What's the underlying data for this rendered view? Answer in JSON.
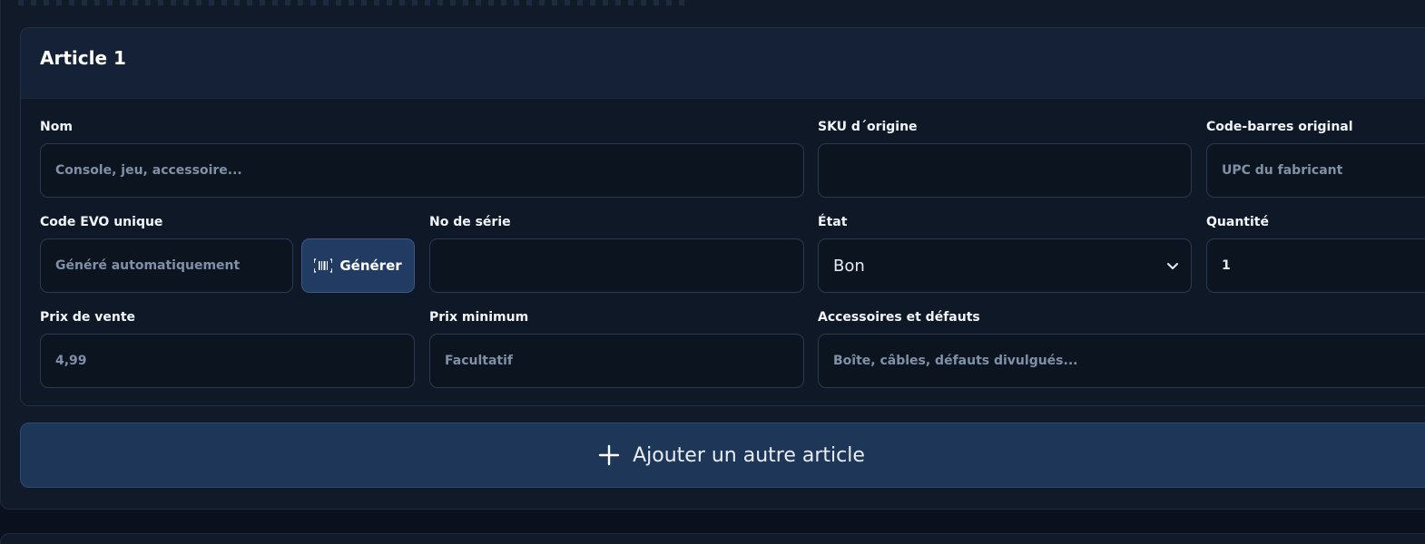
{
  "article": {
    "title": "Article 1",
    "fields": {
      "nom": {
        "label": "Nom",
        "placeholder": "Console, jeu, accessoire...",
        "value": ""
      },
      "sku": {
        "label": "SKU d´origine",
        "placeholder": "",
        "value": ""
      },
      "barcode": {
        "label": "Code-barres original",
        "placeholder": "UPC du fabricant",
        "value": ""
      },
      "evo": {
        "label": "Code EVO unique",
        "placeholder": "Généré automatiquement",
        "value": ""
      },
      "generate_label": "Générer",
      "serial": {
        "label": "No de série",
        "placeholder": "",
        "value": ""
      },
      "etat": {
        "label": "État",
        "value": "Bon"
      },
      "quantite": {
        "label": "Quantité",
        "value": "1"
      },
      "prix_vente": {
        "label": "Prix de vente",
        "placeholder": "4,99",
        "value": ""
      },
      "prix_min": {
        "label": "Prix minimum",
        "placeholder": "Facultatif",
        "value": ""
      },
      "accessoires": {
        "label": "Accessoires et défauts",
        "placeholder": "Boîte, câbles, défauts divulgués...",
        "value": ""
      }
    }
  },
  "add_article_label": "Ajouter un autre article",
  "icons": {
    "generate": "barcode-icon",
    "select": "chevron-down-icon",
    "add": "plus-icon"
  }
}
